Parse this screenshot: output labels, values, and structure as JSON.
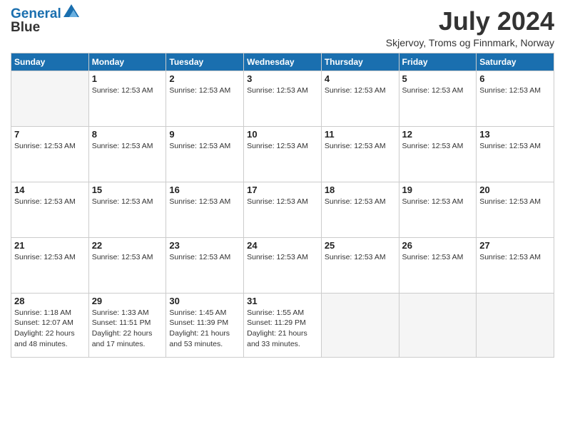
{
  "logo": {
    "line1": "General",
    "line2": "Blue"
  },
  "title": "July 2024",
  "location": "Skjervoy, Troms og Finnmark, Norway",
  "days_of_week": [
    "Sunday",
    "Monday",
    "Tuesday",
    "Wednesday",
    "Thursday",
    "Friday",
    "Saturday"
  ],
  "weeks": [
    [
      {
        "num": "",
        "info": ""
      },
      {
        "num": "1",
        "info": "Sunrise: 12:53 AM"
      },
      {
        "num": "2",
        "info": "Sunrise: 12:53 AM"
      },
      {
        "num": "3",
        "info": "Sunrise: 12:53 AM"
      },
      {
        "num": "4",
        "info": "Sunrise: 12:53 AM"
      },
      {
        "num": "5",
        "info": "Sunrise: 12:53 AM"
      },
      {
        "num": "6",
        "info": "Sunrise: 12:53 AM"
      }
    ],
    [
      {
        "num": "7",
        "info": "Sunrise: 12:53 AM"
      },
      {
        "num": "8",
        "info": "Sunrise: 12:53 AM"
      },
      {
        "num": "9",
        "info": "Sunrise: 12:53 AM"
      },
      {
        "num": "10",
        "info": "Sunrise: 12:53 AM"
      },
      {
        "num": "11",
        "info": "Sunrise: 12:53 AM"
      },
      {
        "num": "12",
        "info": "Sunrise: 12:53 AM"
      },
      {
        "num": "13",
        "info": "Sunrise: 12:53 AM"
      }
    ],
    [
      {
        "num": "14",
        "info": "Sunrise: 12:53 AM"
      },
      {
        "num": "15",
        "info": "Sunrise: 12:53 AM"
      },
      {
        "num": "16",
        "info": "Sunrise: 12:53 AM"
      },
      {
        "num": "17",
        "info": "Sunrise: 12:53 AM"
      },
      {
        "num": "18",
        "info": "Sunrise: 12:53 AM"
      },
      {
        "num": "19",
        "info": "Sunrise: 12:53 AM"
      },
      {
        "num": "20",
        "info": "Sunrise: 12:53 AM"
      }
    ],
    [
      {
        "num": "21",
        "info": "Sunrise: 12:53 AM"
      },
      {
        "num": "22",
        "info": "Sunrise: 12:53 AM"
      },
      {
        "num": "23",
        "info": "Sunrise: 12:53 AM"
      },
      {
        "num": "24",
        "info": "Sunrise: 12:53 AM"
      },
      {
        "num": "25",
        "info": "Sunrise: 12:53 AM"
      },
      {
        "num": "26",
        "info": "Sunrise: 12:53 AM"
      },
      {
        "num": "27",
        "info": "Sunrise: 12:53 AM"
      }
    ],
    [
      {
        "num": "28",
        "info": "Sunrise: 1:18 AM\nSunset: 12:07 AM\nDaylight: 22 hours and 48 minutes."
      },
      {
        "num": "29",
        "info": "Sunrise: 1:33 AM\nSunset: 11:51 PM\nDaylight: 22 hours and 17 minutes."
      },
      {
        "num": "30",
        "info": "Sunrise: 1:45 AM\nSunset: 11:39 PM\nDaylight: 21 hours and 53 minutes."
      },
      {
        "num": "31",
        "info": "Sunrise: 1:55 AM\nSunset: 11:29 PM\nDaylight: 21 hours and 33 minutes."
      },
      {
        "num": "",
        "info": ""
      },
      {
        "num": "",
        "info": ""
      },
      {
        "num": "",
        "info": ""
      }
    ]
  ]
}
